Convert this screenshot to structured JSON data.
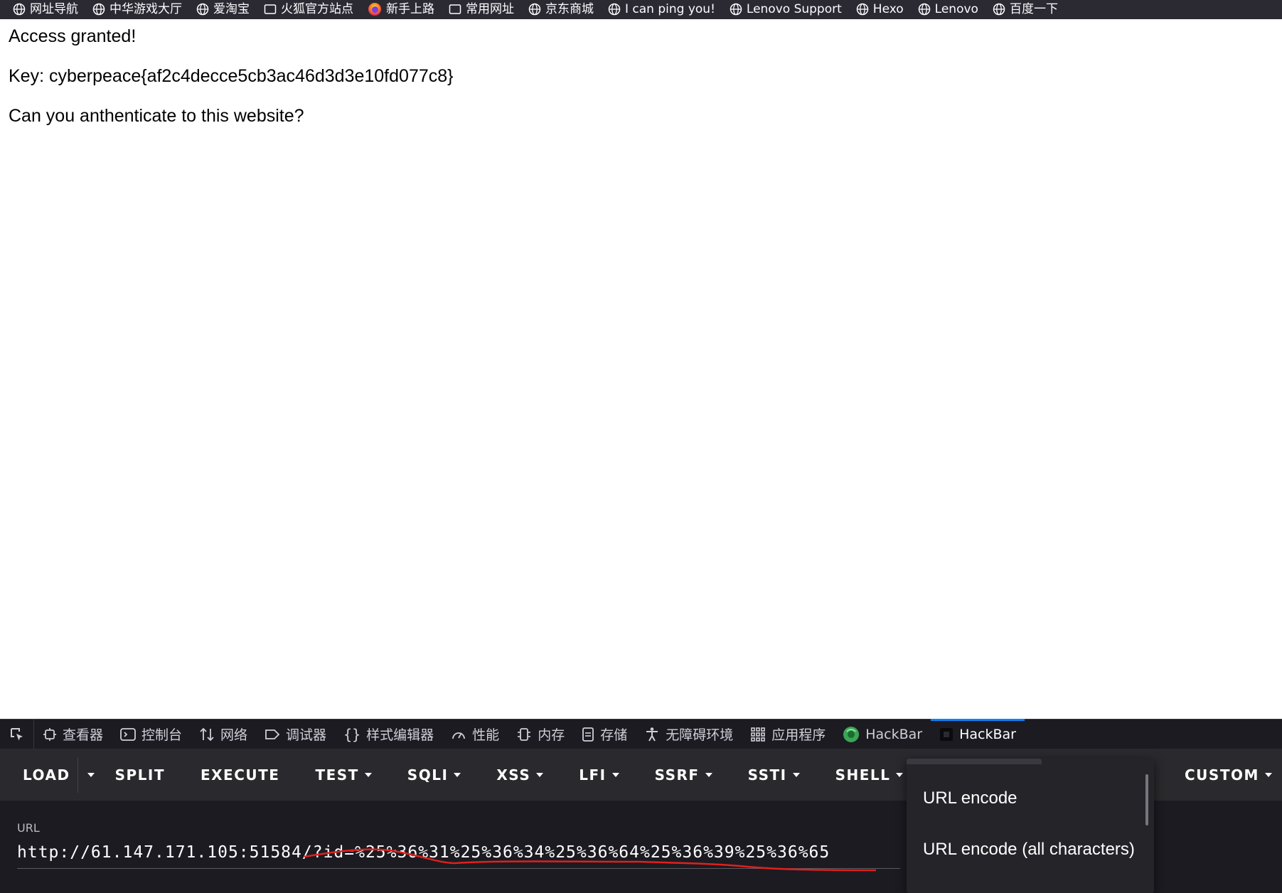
{
  "bookmarks": [
    {
      "label": "网址导航",
      "icon": "globe-icon"
    },
    {
      "label": "中华游戏大厅",
      "icon": "globe-icon"
    },
    {
      "label": "爱淘宝",
      "icon": "globe-icon"
    },
    {
      "label": "火狐官方站点",
      "icon": "folder-icon"
    },
    {
      "label": "新手上路",
      "icon": "firefox-icon"
    },
    {
      "label": "常用网址",
      "icon": "folder-icon"
    },
    {
      "label": "京东商城",
      "icon": "globe-icon"
    },
    {
      "label": "I can ping you!",
      "icon": "globe-icon"
    },
    {
      "label": "Lenovo Support",
      "icon": "globe-icon"
    },
    {
      "label": "Hexo",
      "icon": "globe-icon"
    },
    {
      "label": "Lenovo",
      "icon": "globe-icon"
    },
    {
      "label": "百度一下",
      "icon": "globe-icon"
    }
  ],
  "page": {
    "line1": "Access granted!",
    "line2": "Key: cyberpeace{af2c4decce5cb3ac46d3d3e10fd077c8}",
    "line3": "Can you anthenticate to this website?"
  },
  "devtools": {
    "tabs": [
      {
        "label": "查看器",
        "icon": "inspector-icon"
      },
      {
        "label": "控制台",
        "icon": "console-icon"
      },
      {
        "label": "网络",
        "icon": "network-icon"
      },
      {
        "label": "调试器",
        "icon": "debugger-icon"
      },
      {
        "label": "样式编辑器",
        "icon": "style-editor-icon"
      },
      {
        "label": "性能",
        "icon": "performance-icon"
      },
      {
        "label": "内存",
        "icon": "memory-icon"
      },
      {
        "label": "存储",
        "icon": "storage-icon"
      },
      {
        "label": "无障碍环境",
        "icon": "accessibility-icon"
      },
      {
        "label": "应用程序",
        "icon": "application-icon"
      },
      {
        "label": "HackBar",
        "icon": "hackbar-green-icon"
      },
      {
        "label": "HackBar",
        "icon": "hackbar-dark-icon",
        "active": true
      }
    ]
  },
  "hackbar": {
    "buttons": {
      "load": "LOAD",
      "split": "SPLIT",
      "execute": "EXECUTE",
      "test": "TEST",
      "sqli": "SQLI",
      "xss": "XSS",
      "lfi": "LFI",
      "ssrf": "SSRF",
      "ssti": "SSTI",
      "shell": "SHELL",
      "custom": "CUSTOM"
    },
    "url_label": "URL",
    "url_value": "http://61.147.171.105:51584/?id=%25%36%31%25%36%34%25%36%64%25%36%39%25%36%65",
    "dropdown": {
      "items": [
        "URL encode",
        "URL encode (all characters)"
      ]
    }
  },
  "colors": {
    "bookmarks_bg": "#2b2a33",
    "devtools_bg": "#1c1b22",
    "hackbar_bg": "#2a2a2e",
    "active_tab_accent": "#0a84ff",
    "annotation_red": "#e0201c"
  }
}
